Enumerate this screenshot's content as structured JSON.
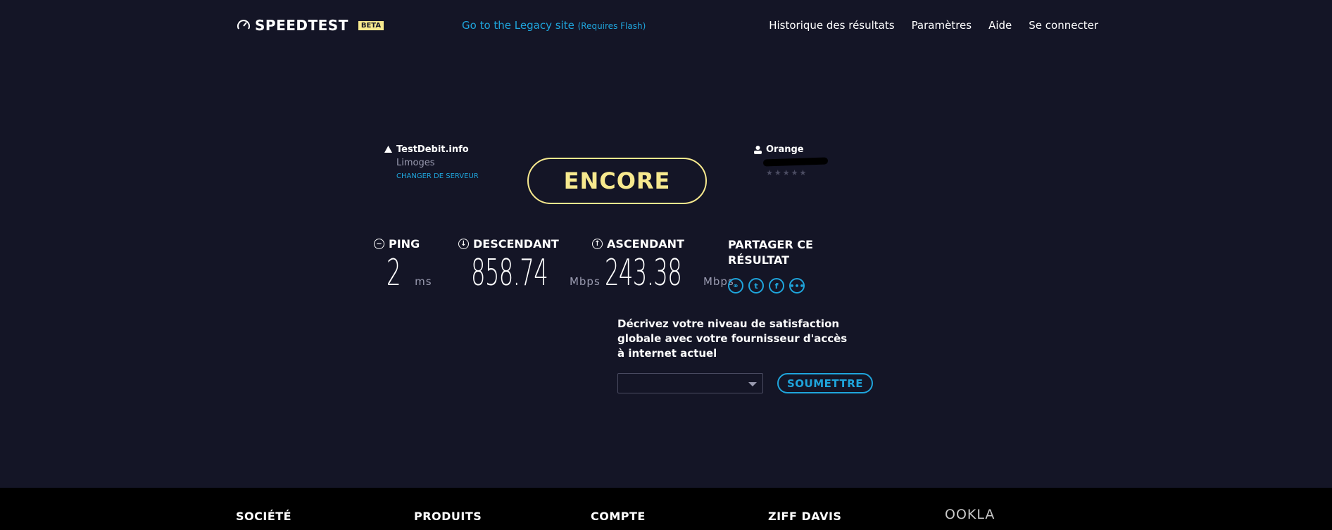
{
  "header": {
    "logo_text": "SPEEDTEST",
    "beta_label": "BETA",
    "legacy_link": "Go to the Legacy site",
    "legacy_note": "(Requires Flash)",
    "nav": [
      "Historique des résultats",
      "Paramètres",
      "Aide",
      "Se connecter"
    ]
  },
  "server": {
    "name": "TestDebit.info",
    "location": "Limoges",
    "change_label": "CHANGER DE SERVEUR"
  },
  "provider": {
    "name": "Orange",
    "stars": "★★★★★"
  },
  "action": {
    "encore_label": "ENCORE"
  },
  "metrics": {
    "ping": {
      "label": "PING",
      "value": "2",
      "unit": "ms"
    },
    "download": {
      "label": "DESCENDANT",
      "value": "858.74",
      "unit": "Mbps"
    },
    "upload": {
      "label": "ASCENDANT",
      "value": "243.38",
      "unit": "Mbps"
    }
  },
  "share": {
    "title_line1": "PARTAGER CE",
    "title_line2": "RÉSULTAT",
    "icons": [
      "link-icon",
      "twitter-icon",
      "facebook-icon",
      "more-icon"
    ]
  },
  "survey": {
    "question": "Décrivez votre niveau de satisfaction globale avec votre fournisseur d'accès à internet actuel",
    "select_value": "",
    "submit_label": "SOUMETTRE"
  },
  "footer": {
    "columns": [
      "SOCIÉTÉ",
      "PRODUITS",
      "COMPTE",
      "ZIFF DAVIS"
    ],
    "brand": "OOKLA"
  },
  "colors": {
    "background": "#141526",
    "accent_blue": "#1fa5dc",
    "accent_yellow": "#f7e98e",
    "footer_bg": "#000000"
  }
}
